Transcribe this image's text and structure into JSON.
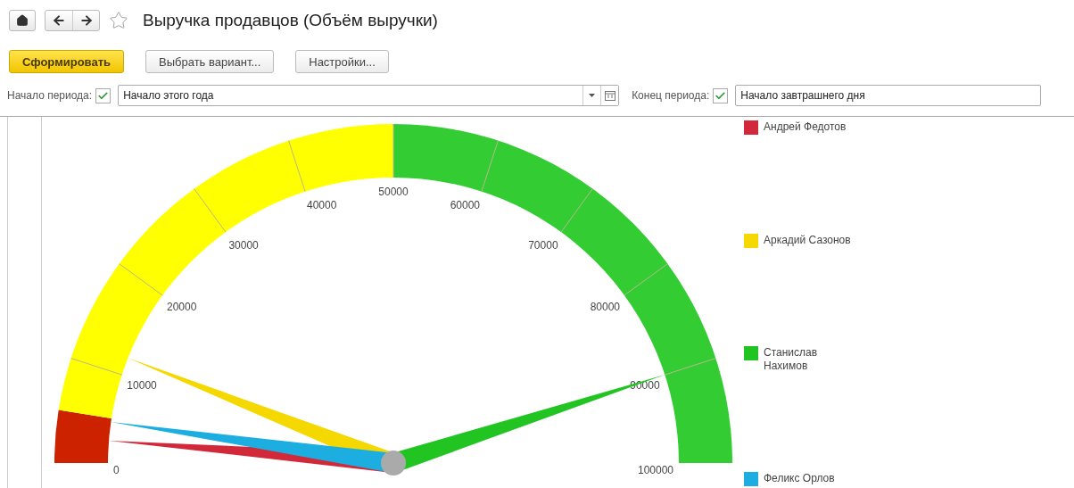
{
  "window": {
    "title": "Выручка продавцов (Объём выручки)",
    "favorite": false
  },
  "toolbar": [
    {
      "label": "Сформировать",
      "kind": "primary"
    },
    {
      "label": "Выбрать вариант...",
      "kind": "plain"
    },
    {
      "label": "Настройки...",
      "kind": "plain"
    }
  ],
  "period_start": {
    "label": "Начало периода:",
    "checked": true,
    "value": "Начало этого года"
  },
  "period_end": {
    "label": "Конец периода:",
    "checked": true,
    "value": "Начало завтрашнего дня"
  },
  "gauge": {
    "ticks": [
      "0",
      "10000",
      "20000",
      "30000",
      "40000",
      "50000",
      "60000",
      "70000",
      "80000",
      "90000",
      "100000"
    ],
    "bands": [
      {
        "color": "#cc2200"
      },
      {
        "color": "#ffff00"
      },
      {
        "color": "#33cc33"
      }
    ],
    "series": [
      {
        "name": "Андрей Федотов",
        "color": "#d1293a"
      },
      {
        "name": "Аркадий Сазонов",
        "color": "#f5d800"
      },
      {
        "name": "Станислав Нахимов",
        "color": "#22c422"
      },
      {
        "name": "Феликс Орлов",
        "color": "#1caee0"
      }
    ]
  }
}
